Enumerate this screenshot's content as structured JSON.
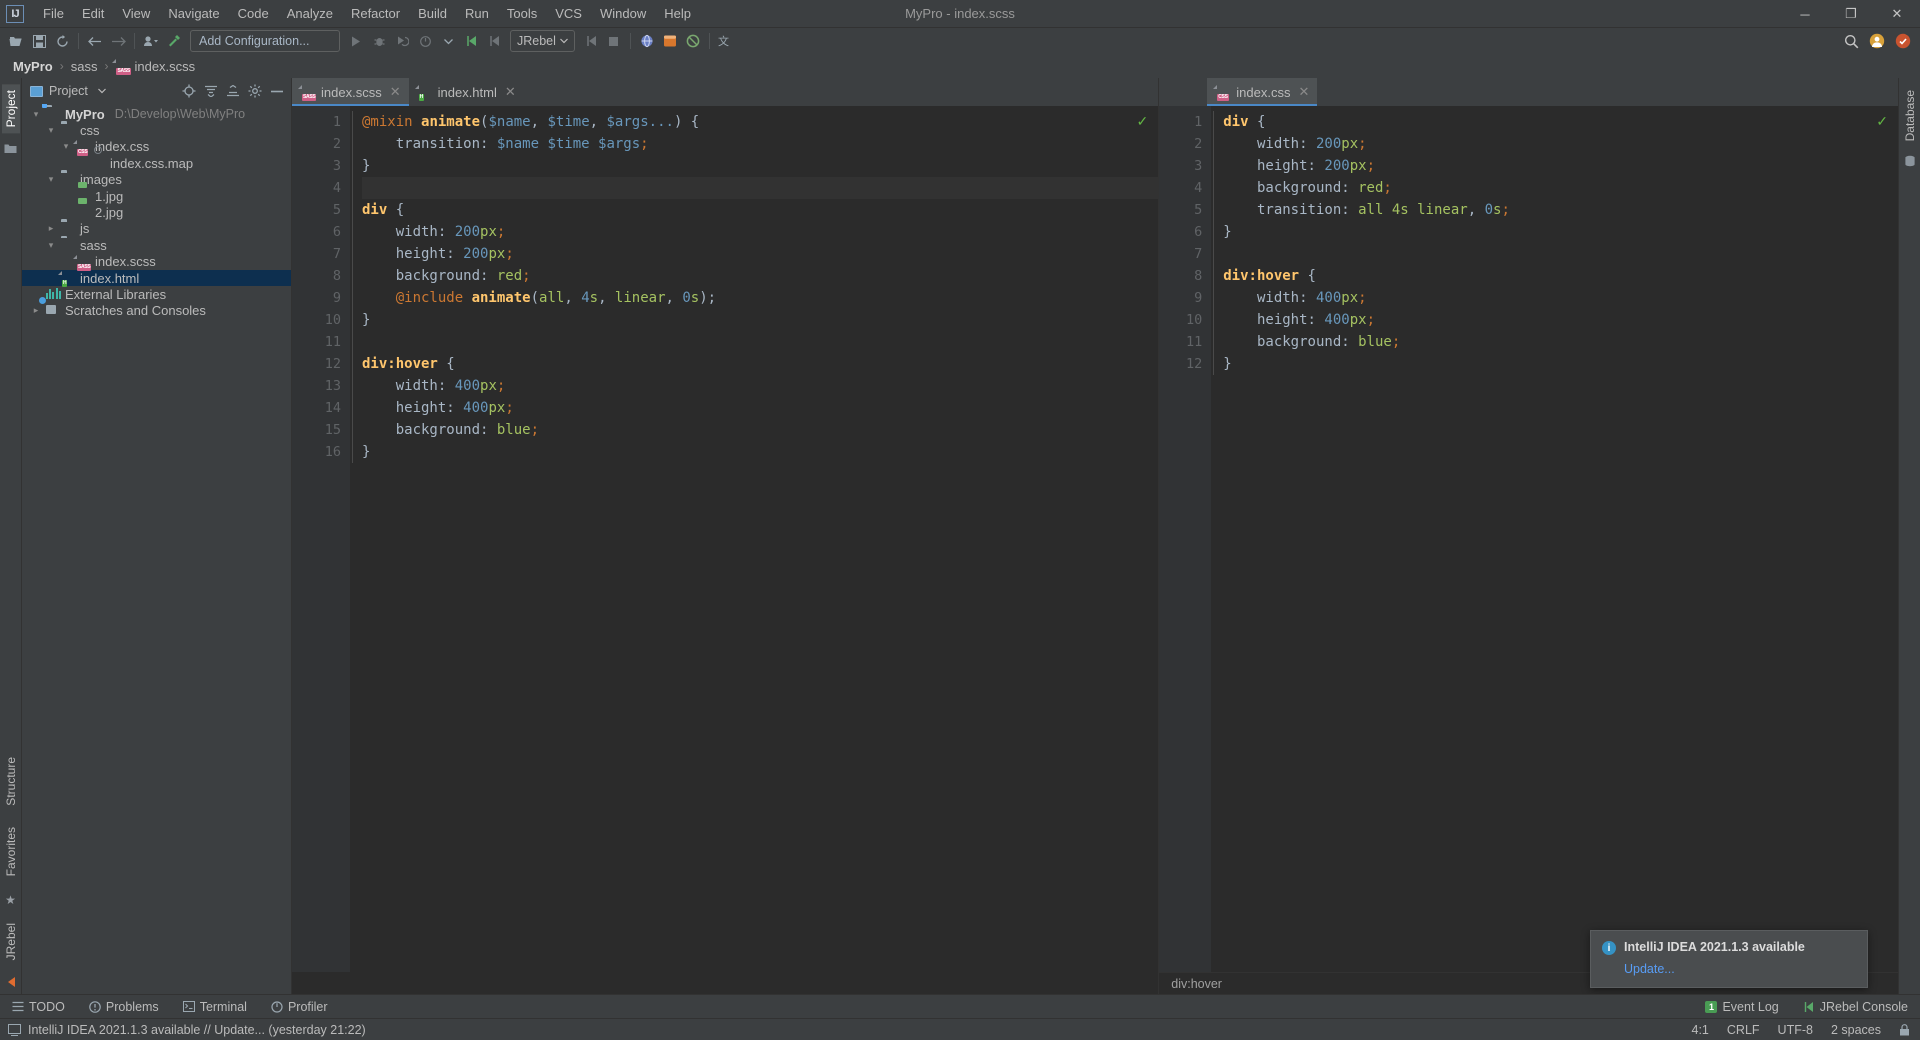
{
  "window": {
    "title": "MyPro - index.scss",
    "logo": "IJ",
    "minimize": "─",
    "maximize": "❐",
    "close": "✕"
  },
  "menubar": {
    "items": [
      {
        "label": "File"
      },
      {
        "label": "Edit"
      },
      {
        "label": "View"
      },
      {
        "label": "Navigate"
      },
      {
        "label": "Code"
      },
      {
        "label": "Analyze"
      },
      {
        "label": "Refactor"
      },
      {
        "label": "Build"
      },
      {
        "label": "Run"
      },
      {
        "label": "Tools"
      },
      {
        "label": "VCS"
      },
      {
        "label": "Window"
      },
      {
        "label": "Help"
      }
    ]
  },
  "toolbar": {
    "open_icon": "open-folder-icon",
    "save_icon": "save-icon",
    "sync_icon": "sync-icon",
    "back_icon": "back-arrow-icon",
    "forward_icon": "forward-arrow-icon",
    "profile_icon": "user-profile-icon",
    "build_icon": "hammer-icon",
    "run_config": "Add Configuration...",
    "run_icon": "run-icon",
    "debug_icon": "debug-icon",
    "coverage_icon": "coverage-icon",
    "profiler_icon": "profiler-icon",
    "jrebel_label": "JRebel",
    "search_icon": "search-icon",
    "plugin_icon": "plugin-icon",
    "translate_icon": "translate-icon"
  },
  "breadcrumb": {
    "items": [
      {
        "label": "MyPro",
        "bold": true
      },
      {
        "label": "sass",
        "bold": false
      },
      {
        "label": "index.scss",
        "bold": false,
        "icon": "sass-file-icon"
      }
    ],
    "separator": "›"
  },
  "left_rail": {
    "project_tab": "Project",
    "structure_tab": "Structure",
    "favorites_tab": "Favorites",
    "jrebel_tab": "JRebel"
  },
  "right_rail": {
    "database_tab": "Database"
  },
  "project_panel": {
    "title": "Project",
    "dropdown_icon": "chevron-down-icon",
    "actions": [
      {
        "name": "locate-icon",
        "glyph": "⊕"
      },
      {
        "name": "expand-all-icon",
        "glyph": "≡"
      },
      {
        "name": "collapse-all-icon",
        "glyph": "≡"
      },
      {
        "name": "settings-gear-icon",
        "glyph": "⚙"
      },
      {
        "name": "hide-panel-icon",
        "glyph": "─"
      }
    ],
    "tree": [
      {
        "label": "MyPro",
        "path": "D:\\Develop\\Web\\MyPro",
        "indent": 0,
        "arrow": "⌄",
        "icon": "module-folder-icon",
        "bold": true,
        "selected": false
      },
      {
        "label": "css",
        "path": "",
        "indent": 1,
        "arrow": "⌄",
        "icon": "folder-icon",
        "bold": false,
        "selected": false
      },
      {
        "label": "index.css",
        "path": "",
        "indent": 2,
        "arrow": "⌄",
        "icon": "css-file-icon",
        "bold": false,
        "selected": false
      },
      {
        "label": "index.css.map",
        "path": "",
        "indent": 3,
        "arrow": "",
        "icon": "map-file-icon",
        "bold": false,
        "selected": false
      },
      {
        "label": "images",
        "path": "",
        "indent": 1,
        "arrow": "⌄",
        "icon": "folder-icon",
        "bold": false,
        "selected": false
      },
      {
        "label": "1.jpg",
        "path": "",
        "indent": 2,
        "arrow": "",
        "icon": "image-file-icon",
        "bold": false,
        "selected": false
      },
      {
        "label": "2.jpg",
        "path": "",
        "indent": 2,
        "arrow": "",
        "icon": "image-file-icon",
        "bold": false,
        "selected": false
      },
      {
        "label": "js",
        "path": "",
        "indent": 1,
        "arrow": "›",
        "icon": "folder-icon",
        "bold": false,
        "selected": false
      },
      {
        "label": "sass",
        "path": "",
        "indent": 1,
        "arrow": "⌄",
        "icon": "folder-icon",
        "bold": false,
        "selected": false
      },
      {
        "label": "index.scss",
        "path": "",
        "indent": 2,
        "arrow": "",
        "icon": "sass-file-icon",
        "bold": false,
        "selected": false
      },
      {
        "label": "index.html",
        "path": "",
        "indent": 1,
        "arrow": "",
        "icon": "html-file-icon",
        "bold": false,
        "selected": true
      },
      {
        "label": "External Libraries",
        "path": "",
        "indent": 0,
        "arrow": "",
        "icon": "libraries-icon",
        "bold": false,
        "selected": false
      },
      {
        "label": "Scratches and Consoles",
        "path": "",
        "indent": 0,
        "arrow": "›",
        "icon": "scratches-icon",
        "bold": false,
        "selected": false
      }
    ]
  },
  "editor_left": {
    "tabs": [
      {
        "label": "index.scss",
        "icon": "sass-file-icon",
        "active": true,
        "close": "✕"
      },
      {
        "label": "index.html",
        "icon": "html-file-icon",
        "active": false,
        "close": "✕"
      }
    ],
    "inspection_ok": "✓",
    "breadcrumb_bottom": "",
    "lines": [
      {
        "n": "1",
        "fold": "⊕",
        "marker": "",
        "caret": false,
        "tokens": [
          {
            "t": "@mixin ",
            "c": "t-kw"
          },
          {
            "t": "animate",
            "c": "t-mixin"
          },
          {
            "t": "(",
            "c": "t-punc"
          },
          {
            "t": "$name",
            "c": "t-var"
          },
          {
            "t": ", ",
            "c": "t-punc"
          },
          {
            "t": "$time",
            "c": "t-var"
          },
          {
            "t": ", ",
            "c": "t-punc"
          },
          {
            "t": "$args...",
            "c": "t-var"
          },
          {
            "t": ") {",
            "c": "t-punc"
          }
        ]
      },
      {
        "n": "2",
        "fold": "",
        "marker": "",
        "caret": false,
        "tokens": [
          {
            "t": "    transition",
            "c": "t-prop"
          },
          {
            "t": ": ",
            "c": "t-punc"
          },
          {
            "t": "$name $time $args",
            "c": "t-var"
          },
          {
            "t": ";",
            "c": "t-semi"
          }
        ]
      },
      {
        "n": "3",
        "fold": "⊖",
        "marker": "",
        "caret": false,
        "tokens": [
          {
            "t": "}",
            "c": "t-punc"
          }
        ]
      },
      {
        "n": "4",
        "fold": "",
        "marker": "",
        "caret": true,
        "tokens": [
          {
            "t": "",
            "c": "t-punc"
          }
        ]
      },
      {
        "n": "5",
        "fold": "⊕",
        "marker": "",
        "caret": false,
        "tokens": [
          {
            "t": "div",
            "c": "t-sel"
          },
          {
            "t": " {",
            "c": "t-punc"
          }
        ]
      },
      {
        "n": "6",
        "fold": "",
        "marker": "",
        "caret": false,
        "tokens": [
          {
            "t": "    width",
            "c": "t-prop"
          },
          {
            "t": ": ",
            "c": "t-punc"
          },
          {
            "t": "200",
            "c": "t-num"
          },
          {
            "t": "px",
            "c": "t-unit"
          },
          {
            "t": ";",
            "c": "t-semi"
          }
        ]
      },
      {
        "n": "7",
        "fold": "",
        "marker": "",
        "caret": false,
        "tokens": [
          {
            "t": "    height",
            "c": "t-prop"
          },
          {
            "t": ": ",
            "c": "t-punc"
          },
          {
            "t": "200",
            "c": "t-num"
          },
          {
            "t": "px",
            "c": "t-unit"
          },
          {
            "t": ";",
            "c": "t-semi"
          }
        ]
      },
      {
        "n": "8",
        "fold": "",
        "marker": "#ff0000",
        "caret": false,
        "tokens": [
          {
            "t": "    background",
            "c": "t-prop"
          },
          {
            "t": ": ",
            "c": "t-punc"
          },
          {
            "t": "red",
            "c": "t-val"
          },
          {
            "t": ";",
            "c": "t-semi"
          }
        ]
      },
      {
        "n": "9",
        "fold": "",
        "marker": "",
        "caret": false,
        "tokens": [
          {
            "t": "    @include ",
            "c": "t-kw"
          },
          {
            "t": "animate",
            "c": "t-mixin"
          },
          {
            "t": "(",
            "c": "t-punc"
          },
          {
            "t": "all",
            "c": "t-val"
          },
          {
            "t": ", ",
            "c": "t-punc"
          },
          {
            "t": "4",
            "c": "t-num"
          },
          {
            "t": "s",
            "c": "t-unit"
          },
          {
            "t": ", ",
            "c": "t-punc"
          },
          {
            "t": "linear",
            "c": "t-val"
          },
          {
            "t": ", ",
            "c": "t-punc"
          },
          {
            "t": "0",
            "c": "t-num"
          },
          {
            "t": "s",
            "c": "t-unit"
          },
          {
            "t": ");",
            "c": "t-punc"
          }
        ]
      },
      {
        "n": "10",
        "fold": "⊖",
        "marker": "",
        "caret": false,
        "tokens": [
          {
            "t": "}",
            "c": "t-punc"
          }
        ]
      },
      {
        "n": "11",
        "fold": "",
        "marker": "",
        "caret": false,
        "tokens": [
          {
            "t": "",
            "c": "t-punc"
          }
        ]
      },
      {
        "n": "12",
        "fold": "⊕",
        "marker": "",
        "caret": false,
        "tokens": [
          {
            "t": "div:hover",
            "c": "t-sel"
          },
          {
            "t": " {",
            "c": "t-punc"
          }
        ]
      },
      {
        "n": "13",
        "fold": "",
        "marker": "",
        "caret": false,
        "tokens": [
          {
            "t": "    width",
            "c": "t-prop"
          },
          {
            "t": ": ",
            "c": "t-punc"
          },
          {
            "t": "400",
            "c": "t-num"
          },
          {
            "t": "px",
            "c": "t-unit"
          },
          {
            "t": ";",
            "c": "t-semi"
          }
        ]
      },
      {
        "n": "14",
        "fold": "",
        "marker": "",
        "caret": false,
        "tokens": [
          {
            "t": "    height",
            "c": "t-prop"
          },
          {
            "t": ": ",
            "c": "t-punc"
          },
          {
            "t": "400",
            "c": "t-num"
          },
          {
            "t": "px",
            "c": "t-unit"
          },
          {
            "t": ";",
            "c": "t-semi"
          }
        ]
      },
      {
        "n": "15",
        "fold": "",
        "marker": "#1326ff",
        "caret": false,
        "tokens": [
          {
            "t": "    background",
            "c": "t-prop"
          },
          {
            "t": ": ",
            "c": "t-punc"
          },
          {
            "t": "blue",
            "c": "t-val"
          },
          {
            "t": ";",
            "c": "t-semi"
          }
        ]
      },
      {
        "n": "16",
        "fold": "⊖",
        "marker": "",
        "caret": false,
        "tokens": [
          {
            "t": "}",
            "c": "t-punc"
          }
        ]
      }
    ]
  },
  "editor_right": {
    "tabs": [
      {
        "label": "index.css",
        "icon": "css-file-icon",
        "active": true,
        "close": "✕"
      }
    ],
    "inspection_ok": "✓",
    "breadcrumb_bottom": "div:hover",
    "lines": [
      {
        "n": "1",
        "fold": "⊕",
        "marker": "",
        "caret": false,
        "tokens": [
          {
            "t": "div",
            "c": "t-sel"
          },
          {
            "t": " {",
            "c": "t-punc"
          }
        ]
      },
      {
        "n": "2",
        "fold": "",
        "marker": "",
        "caret": false,
        "tokens": [
          {
            "t": "    width",
            "c": "t-prop"
          },
          {
            "t": ": ",
            "c": "t-punc"
          },
          {
            "t": "200",
            "c": "t-num"
          },
          {
            "t": "px",
            "c": "t-unit"
          },
          {
            "t": ";",
            "c": "t-semi"
          }
        ]
      },
      {
        "n": "3",
        "fold": "",
        "marker": "",
        "caret": false,
        "tokens": [
          {
            "t": "    height",
            "c": "t-prop"
          },
          {
            "t": ": ",
            "c": "t-punc"
          },
          {
            "t": "200",
            "c": "t-num"
          },
          {
            "t": "px",
            "c": "t-unit"
          },
          {
            "t": ";",
            "c": "t-semi"
          }
        ]
      },
      {
        "n": "4",
        "fold": "",
        "marker": "#ff0000",
        "caret": false,
        "tokens": [
          {
            "t": "    background",
            "c": "t-prop"
          },
          {
            "t": ": ",
            "c": "t-punc"
          },
          {
            "t": "red",
            "c": "t-val"
          },
          {
            "t": ";",
            "c": "t-semi"
          }
        ]
      },
      {
        "n": "5",
        "fold": "",
        "marker": "",
        "caret": false,
        "tokens": [
          {
            "t": "    transition",
            "c": "t-prop"
          },
          {
            "t": ": ",
            "c": "t-punc"
          },
          {
            "t": "all 4s linear",
            "c": "t-val"
          },
          {
            "t": ", ",
            "c": "t-punc"
          },
          {
            "t": "0",
            "c": "t-num"
          },
          {
            "t": "s",
            "c": "t-unit"
          },
          {
            "t": ";",
            "c": "t-semi"
          }
        ]
      },
      {
        "n": "6",
        "fold": "⊖",
        "marker": "",
        "caret": false,
        "tokens": [
          {
            "t": "}",
            "c": "t-punc"
          }
        ]
      },
      {
        "n": "7",
        "fold": "",
        "marker": "",
        "caret": false,
        "tokens": [
          {
            "t": "",
            "c": "t-punc"
          }
        ]
      },
      {
        "n": "8",
        "fold": "⊕",
        "marker": "",
        "caret": false,
        "tokens": [
          {
            "t": "div:hover",
            "c": "t-sel"
          },
          {
            "t": " {",
            "c": "t-punc"
          }
        ]
      },
      {
        "n": "9",
        "fold": "",
        "marker": "",
        "caret": false,
        "tokens": [
          {
            "t": "    width",
            "c": "t-prop"
          },
          {
            "t": ": ",
            "c": "t-punc"
          },
          {
            "t": "400",
            "c": "t-num"
          },
          {
            "t": "px",
            "c": "t-unit"
          },
          {
            "t": ";",
            "c": "t-semi"
          }
        ]
      },
      {
        "n": "10",
        "fold": "",
        "marker": "",
        "caret": false,
        "tokens": [
          {
            "t": "    height",
            "c": "t-prop"
          },
          {
            "t": ": ",
            "c": "t-punc"
          },
          {
            "t": "400",
            "c": "t-num"
          },
          {
            "t": "px",
            "c": "t-unit"
          },
          {
            "t": ";",
            "c": "t-semi"
          }
        ]
      },
      {
        "n": "11",
        "fold": "",
        "marker": "#1326ff",
        "caret": false,
        "tokens": [
          {
            "t": "    background",
            "c": "t-prop"
          },
          {
            "t": ": ",
            "c": "t-punc"
          },
          {
            "t": "blue",
            "c": "t-val"
          },
          {
            "t": ";",
            "c": "t-semi"
          }
        ]
      },
      {
        "n": "12",
        "fold": "⊖",
        "marker": "",
        "caret": false,
        "tokens": [
          {
            "t": "}",
            "c": "t-punc"
          }
        ]
      }
    ]
  },
  "notification": {
    "icon": "info-icon",
    "icon_glyph": "i",
    "title": "IntelliJ IDEA 2021.1.3 available",
    "link": "Update..."
  },
  "toolwindow_bar": {
    "items": [
      {
        "label": "TODO",
        "icon": "todo-icon",
        "glyph": "≡"
      },
      {
        "label": "Problems",
        "icon": "problems-icon",
        "glyph": "ⓘ"
      },
      {
        "label": "Terminal",
        "icon": "terminal-icon",
        "glyph": "▣"
      },
      {
        "label": "Profiler",
        "icon": "profiler-icon",
        "glyph": "◔"
      }
    ],
    "right_items": [
      {
        "label": "Event Log",
        "icon": "event-log-icon",
        "badge": "1"
      },
      {
        "label": "JRebel Console",
        "icon": "jrebel-icon",
        "badge": ""
      }
    ]
  },
  "statusbar": {
    "icon": "message-icon",
    "message": "IntelliJ IDEA 2021.1.3 available // Update... (yesterday 21:22)",
    "caret_position": "4:1",
    "line_separator": "CRLF",
    "encoding": "UTF-8",
    "indent": "2 spaces",
    "lock_icon": "lock-icon"
  },
  "colors": {
    "accent": "#4a88c7",
    "selection": "#0d2f4f",
    "editor_bg": "#2b2b2b",
    "panel_bg": "#3c3f41",
    "gutter_bg": "#313335",
    "link": "#589df6",
    "ok_green": "#62b543"
  }
}
